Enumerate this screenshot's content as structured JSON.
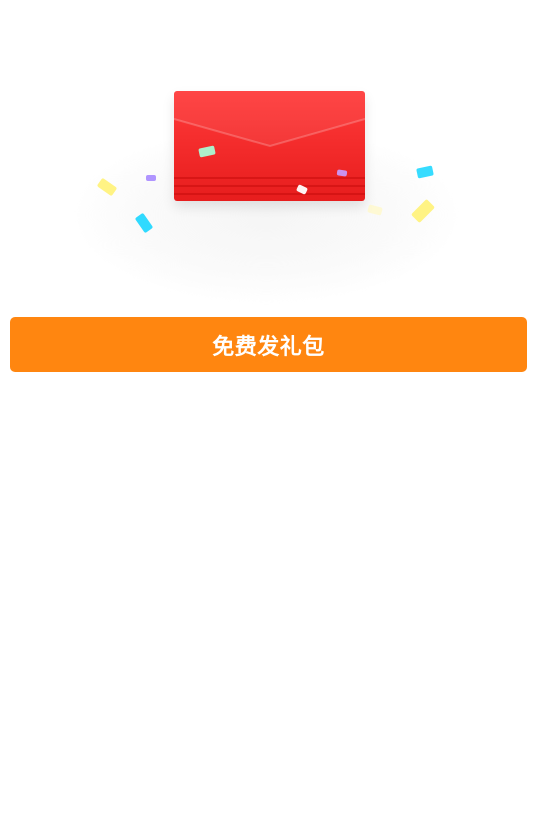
{
  "button": {
    "label": "免费发礼包"
  },
  "colors": {
    "cta_orange": "#ff8610",
    "envelope_red": "#f22a2a",
    "background": "#ffffff",
    "confetti": [
      "#fff27a",
      "#1ed7ff",
      "#a98cff",
      "#a7ffd8",
      "#ffffff"
    ]
  },
  "icons": {
    "envelope": "red-envelope-icon",
    "confetti": "confetti-icon"
  }
}
